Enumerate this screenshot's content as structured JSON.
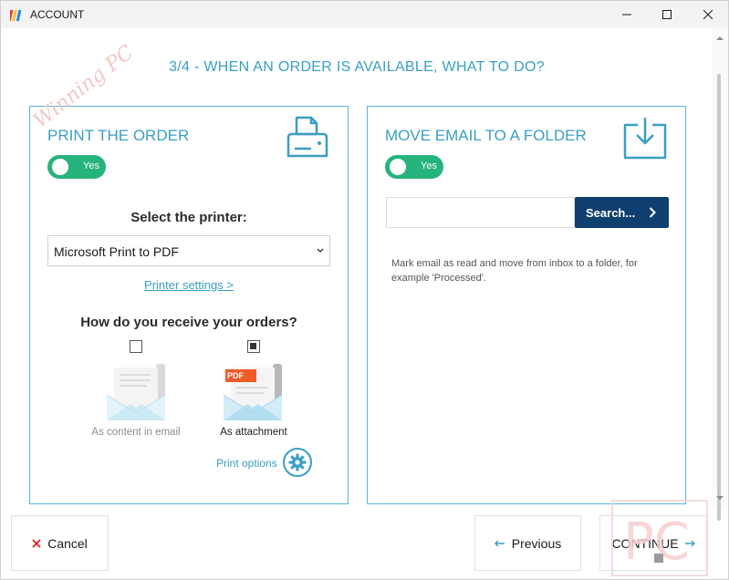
{
  "window": {
    "title": "ACCOUNT"
  },
  "heading": "3/4 - WHEN AN ORDER IS AVAILABLE, WHAT TO DO?",
  "print_panel": {
    "title": "PRINT THE ORDER",
    "toggle_label": "Yes",
    "toggle_on": true,
    "select_label": "Select the printer:",
    "printer_value": "Microsoft Print to PDF",
    "printer_settings_link": "Printer settings >",
    "receive_heading": "How do you receive your orders?",
    "options": [
      {
        "label": "As content in email",
        "checked": false
      },
      {
        "label": "As attachment",
        "checked": true,
        "badge": "PDF"
      }
    ],
    "print_options_link": "Print options"
  },
  "email_panel": {
    "title": "MOVE EMAIL TO A FOLDER",
    "toggle_label": "Yes",
    "toggle_on": true,
    "folder_value": "",
    "search_label": "Search...",
    "hint": "Mark email as read and move from inbox to a folder, for example 'Processed'."
  },
  "footer": {
    "cancel_label": "Cancel",
    "previous_label": "Previous",
    "continue_label": "CONTINUE"
  },
  "watermark": {
    "top_text": "Winning PC",
    "bottom_text": "PC"
  },
  "colors": {
    "accent": "#3a9fc2",
    "toggle": "#27b37c",
    "primary_button": "#0f3f6e",
    "cancel_x": "#e02020",
    "pdf_badge": "#f05a28"
  },
  "icons": {
    "print_panel": "printer-icon",
    "email_panel": "folder-download-icon",
    "print_options": "gear-icon",
    "search": "chevron-right-icon"
  }
}
